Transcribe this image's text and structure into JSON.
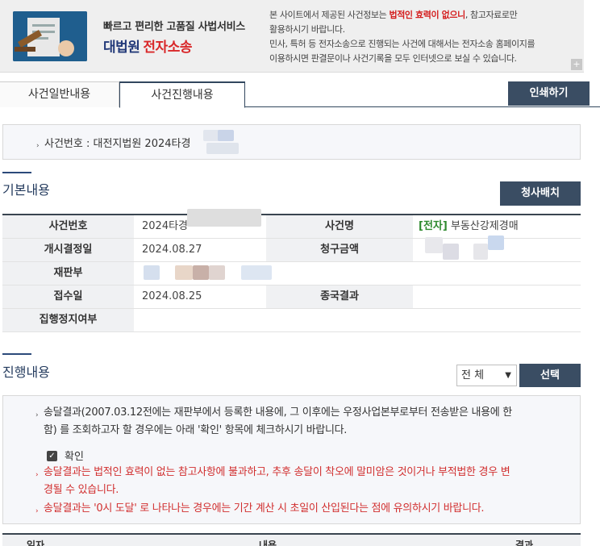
{
  "banner": {
    "subtitle": "빠르고 편리한 고품질 사법서비스",
    "title_part1": "대법원",
    "title_part2": "전자소송",
    "notice_line1_a": "본 사이트에서 제공된 사건정보는 ",
    "notice_line1_red": "법적인 효력이 없으니",
    "notice_line1_b": ", 참고자료로만",
    "notice_line2": "활용하시기 바랍니다.",
    "notice_line3": "민사, 특허 등 전자소송으로 진행되는 사건에 대해서는 전자소송 홈페이지를",
    "notice_line4": "이용하시면 판결문이나 사건기록을 모두 인터넷으로 보실 수 있습니다.",
    "plus": "+"
  },
  "tabs": {
    "general": "사건일반내용",
    "progress": "사건진행내용",
    "print": "인쇄하기"
  },
  "case_header": {
    "bullet": "›",
    "label": "사건번호 : 대전지법원 2024타경"
  },
  "basic": {
    "title": "기본내용",
    "assign_button": "청사배치",
    "rows": [
      {
        "h1": "사건번호",
        "v1": "2024타경",
        "h2": "사건명",
        "v2_tag": "[전자]",
        "v2": "부동산강제경매"
      },
      {
        "h1": "개시결정일",
        "v1": "2024.08.27",
        "h2": "청구금액",
        "v2_tag": "",
        "v2": ""
      },
      {
        "h1": "재판부",
        "v1": "",
        "h2": "",
        "v2_tag": "",
        "v2": ""
      },
      {
        "h1": "접수일",
        "v1": "2024.08.25",
        "h2": "종국결과",
        "v2_tag": "",
        "v2": ""
      },
      {
        "h1": "집행정지여부",
        "v1": "",
        "h2": "",
        "v2_tag": "",
        "v2": ""
      }
    ]
  },
  "progress": {
    "title": "진행내용",
    "filter_value": "전 체",
    "select_button": "선택",
    "notice1_line1": "송달결과(2007.03.12전에는 재판부에서 등록한 내용에, 그 이후에는 우정사업본부로부터 전송받은 내용에 한",
    "notice1_line2": "함) 를 조회하고자 할 경우에는 아래 '확인' 항목에 체크하시기 바랍니다.",
    "checkbox_label": "확인",
    "notice2_line1": "송달결과는 법적인 효력이 없는 참고사항에 불과하고, 추후 송달이 착오에 말미암은 것이거나 부적법한 경우 변",
    "notice2_line2": "경될 수 있습니다.",
    "notice3": "송달결과는 '0시 도달' 로 나타나는 경우에는 기간 계산 시 초일이 산입된다는 점에 유의하시기 바랍니다.",
    "col_date": "일자",
    "col_content": "내용",
    "col_result": "결과"
  },
  "colors": {
    "dark_button": "#3a4d63",
    "accent_red": "#d12f2f",
    "accent_green": "#2e8a2e",
    "heading_blue": "#243b5e"
  }
}
